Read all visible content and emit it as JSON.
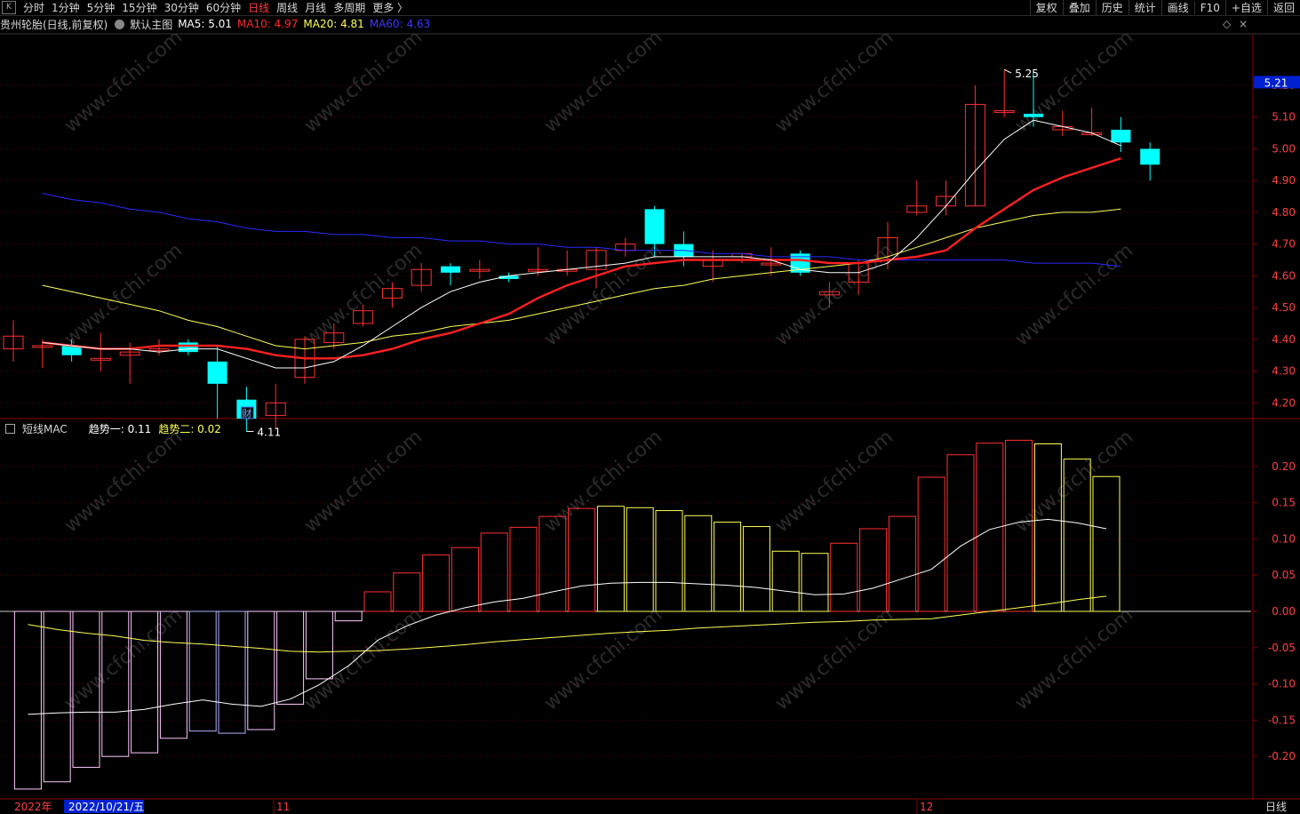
{
  "toolbar": {
    "logo_icon": "app-logo-icon",
    "periods": [
      "分时",
      "1分钟",
      "5分钟",
      "15分钟",
      "30分钟",
      "60分钟",
      "日线",
      "周线",
      "月线",
      "多周期",
      "更多 〉"
    ],
    "active_period": "日线",
    "right_buttons": [
      "复权",
      "叠加",
      "历史",
      "统计",
      "画线",
      "F10",
      "+自选",
      "返回"
    ]
  },
  "info": {
    "stock_title": "贵州轮胎(日线,前复权)",
    "template_label": "默认主图",
    "ma": [
      {
        "label": "MA5: 5.01",
        "color": "#ffffff"
      },
      {
        "label": "MA10: 4.97",
        "color": "#ff2a2a"
      },
      {
        "label": "MA20: 4.81",
        "color": "#ffff55"
      },
      {
        "label": "MA60: 4.63",
        "color": "#3a3aff"
      }
    ]
  },
  "sub_info": {
    "indicator_name": "短线MAC",
    "trend1": "趋势一: 0.11",
    "trend1_color": "#ffffff",
    "trend2": "趋势二: 0.02",
    "trend2_color": "#ffff55"
  },
  "price_axis": {
    "current_price_tag": "5.21",
    "ticks": [
      "5.20",
      "5.10",
      "5.00",
      "4.90",
      "4.80",
      "4.70",
      "4.60",
      "4.50",
      "4.40",
      "4.30",
      "4.20"
    ]
  },
  "mac_axis": {
    "ticks": [
      "0.20",
      "0.15",
      "0.10",
      "0.05",
      "0.00",
      "-0.05",
      "-0.10",
      "-0.15",
      "-0.20"
    ]
  },
  "annotations": {
    "high_label": "5.25",
    "low_label": "4.11",
    "finance_marker": "财"
  },
  "bottom": {
    "year_label": "2022年",
    "date_label": "2022/10/21/五",
    "month_marks": [
      "11",
      "12"
    ],
    "period_label": "日线"
  },
  "watermark": "www.cfchi.com",
  "colors": {
    "up": "#ff3030",
    "down": "#00ffff",
    "axis_red": "#8b0000",
    "ma5": "#ffffff",
    "ma10": "#ff2020",
    "ma20": "#ffff55",
    "ma60": "#2a2aff"
  },
  "chart_data": [
    {
      "type": "candlestick",
      "title": "贵州轮胎(日线,前复权)",
      "ylim": [
        4.14,
        5.28
      ],
      "series_ma": [
        {
          "name": "MA5",
          "last": 5.01
        },
        {
          "name": "MA10",
          "last": 4.97
        },
        {
          "name": "MA20",
          "last": 4.81
        },
        {
          "name": "MA60",
          "last": 4.63
        }
      ],
      "candles": [
        {
          "low": 4.11
        },
        {
          "high": 5.25
        }
      ],
      "high_label": 5.25,
      "low_label": 4.11
    },
    {
      "type": "bar",
      "title": "短线MAC",
      "ylim": [
        -0.255,
        0.255
      ],
      "series": [
        {
          "name": "趋势一",
          "last": 0.11
        },
        {
          "name": "趋势二",
          "last": 0.02
        }
      ]
    }
  ]
}
